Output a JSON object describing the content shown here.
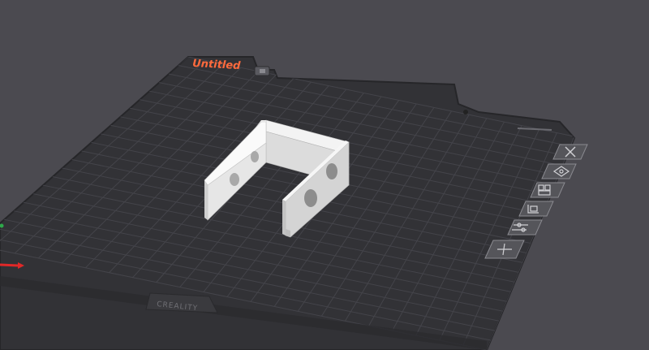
{
  "plate": {
    "name": "Untitled",
    "brand": "CREALITY",
    "name_color": "#ff6a3d"
  },
  "toolbar": {
    "items": [
      {
        "icon": "close-icon"
      },
      {
        "icon": "object-settings-icon"
      },
      {
        "icon": "arrange-icon"
      },
      {
        "icon": "orient-icon"
      },
      {
        "icon": "sliders-icon"
      },
      {
        "icon": "lock-icon"
      }
    ]
  },
  "axis": {
    "x_color": "#e02828",
    "y_color": "#2ea84a"
  }
}
